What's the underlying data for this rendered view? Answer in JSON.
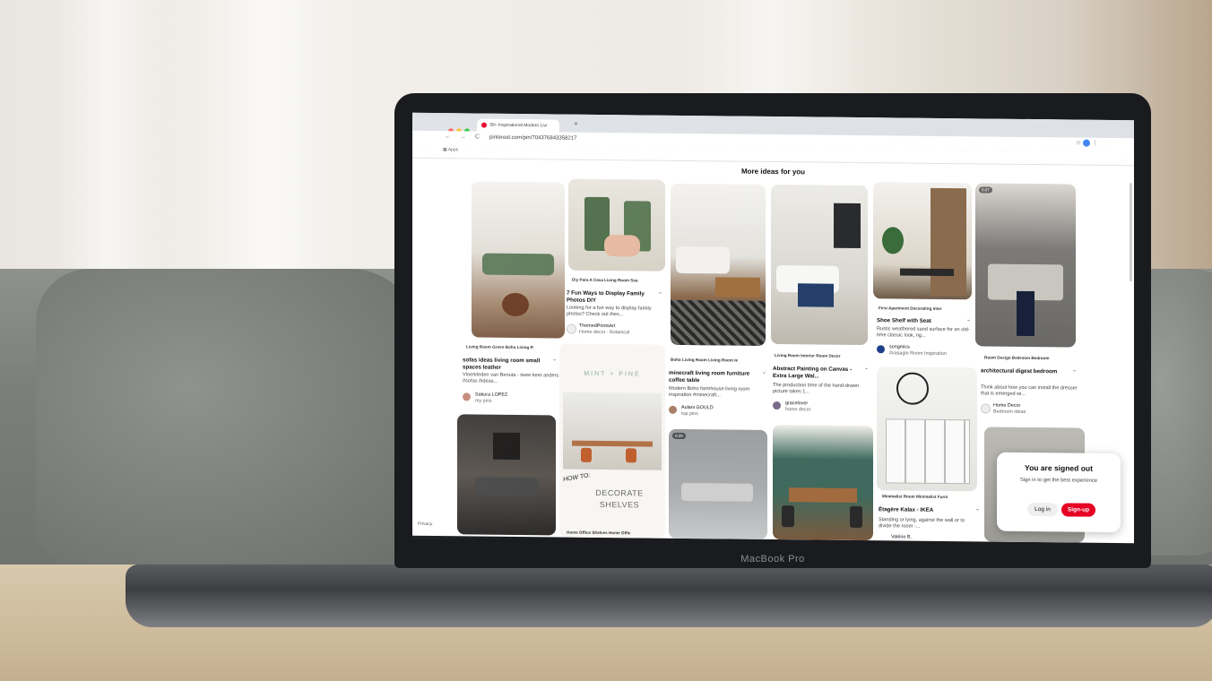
{
  "device": {
    "brand": "MacBook Pro"
  },
  "browser": {
    "tab_title": "30+ Inspirational Modern Livi",
    "new_tab_symbol": "+",
    "url": "pinterest.com/pin/704376843358217",
    "bookmark_apps": "Apps",
    "nav_symbols": "← → C"
  },
  "page": {
    "heading": "More ideas for you",
    "privacy": "Privacy"
  },
  "pins": [
    {
      "cats": "Living Room Green    Boho Living R",
      "title": "sofas ideas living room small spaces leather",
      "desc": "Vloerkleden van Benuta - twee keer anders #sofas #ideas...",
      "user": "Sakura LOPEZ",
      "sub": "my pins"
    },
    {
      "cats": "Diy Para A Casa    Living Room Sea",
      "title": "7 Fun Ways to Display Family Photos DIY",
      "desc": "Looking for a fun way to display family photos? Check out thes...",
      "user": "ThemedPrintsArt",
      "sub": "Home decor - Botanical"
    },
    {
      "cats": "Boho Living Room    Living Room Ie",
      "title": "minecraft living room furniture coffee table",
      "desc": "Modern Boho farmhouse living room inspiration #minecraft...",
      "user": "Aulani GOULD",
      "sub": "top pins"
    },
    {
      "cats": "Living Room Interior    Room Decor",
      "title": "Abstract Painting on Canvas - Extra Large Wal...",
      "desc": "The production time of the hand-drawn picture takes 1...",
      "user": "gracelover",
      "sub": "home decor"
    },
    {
      "cats": "First Apartment Decorating    Inter",
      "title": "Shoe Shelf with Seat",
      "desc": "Rustic weathered sand surface for an old-time classic look, rig...",
      "user": "songmics",
      "sub": "#vasagle Room Inspiration"
    },
    {
      "cats": "Room Design Bedroom    Bedroom",
      "title": "architectural digest bedroom",
      "desc": "Think about how you can install the dresser that is emerged wi...",
      "user": "Home Decor",
      "sub": "Bedroom ideas"
    }
  ],
  "row2": {
    "mint_brand": "MINT + PINE",
    "howto": "HOW TO:",
    "howto_big": "DECORATE SHELVES",
    "cats2": "Home Office Shelves    Home Offic",
    "cats5": "Minimalist Room    Minimalist Furni",
    "title5": "Étagère Kalax - IKEA",
    "desc5": "Standing or lying, against the wall or to divide the room -...",
    "user5": "Valérie B.",
    "badge_a": "0:07",
    "badge_b": "0:39"
  },
  "signed_out": {
    "title": "You are signed out",
    "text": "Sign in to get the best experience",
    "login": "Log in",
    "signup": "Sign-up"
  },
  "colors": {
    "brand_red": "#e60023"
  }
}
